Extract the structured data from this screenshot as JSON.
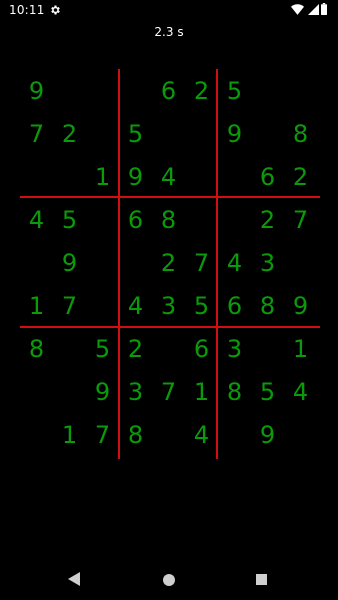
{
  "status_bar": {
    "time": "10:11",
    "icons": [
      "settings-gear-icon",
      "wifi-icon",
      "cell-signal-icon",
      "battery-icon"
    ]
  },
  "timer": {
    "text": "2.3 s"
  },
  "board": {
    "digit_color": "#0a9a0a",
    "grid_color": "#d01010",
    "rows": [
      [
        "9",
        "",
        "",
        "",
        "6",
        "2",
        "5",
        "",
        ""
      ],
      [
        "7",
        "2",
        "",
        "5",
        "",
        "",
        "9",
        "",
        "8"
      ],
      [
        "",
        "",
        "1",
        "9",
        "4",
        "",
        "",
        "6",
        "2"
      ],
      [
        "4",
        "5",
        "",
        "6",
        "8",
        "",
        "",
        "2",
        "7"
      ],
      [
        "",
        "9",
        "",
        "",
        "2",
        "7",
        "4",
        "3",
        ""
      ],
      [
        "1",
        "7",
        "",
        "4",
        "3",
        "5",
        "6",
        "8",
        "9"
      ],
      [
        "8",
        "",
        "5",
        "2",
        "",
        "6",
        "3",
        "",
        "1"
      ],
      [
        "",
        "",
        "9",
        "3",
        "7",
        "1",
        "8",
        "5",
        "4"
      ],
      [
        "",
        "1",
        "7",
        "8",
        "",
        "4",
        "",
        "9",
        ""
      ]
    ]
  },
  "nav_bar": {
    "icons": [
      "back-triangle-icon",
      "home-circle-icon",
      "recents-square-icon"
    ]
  }
}
